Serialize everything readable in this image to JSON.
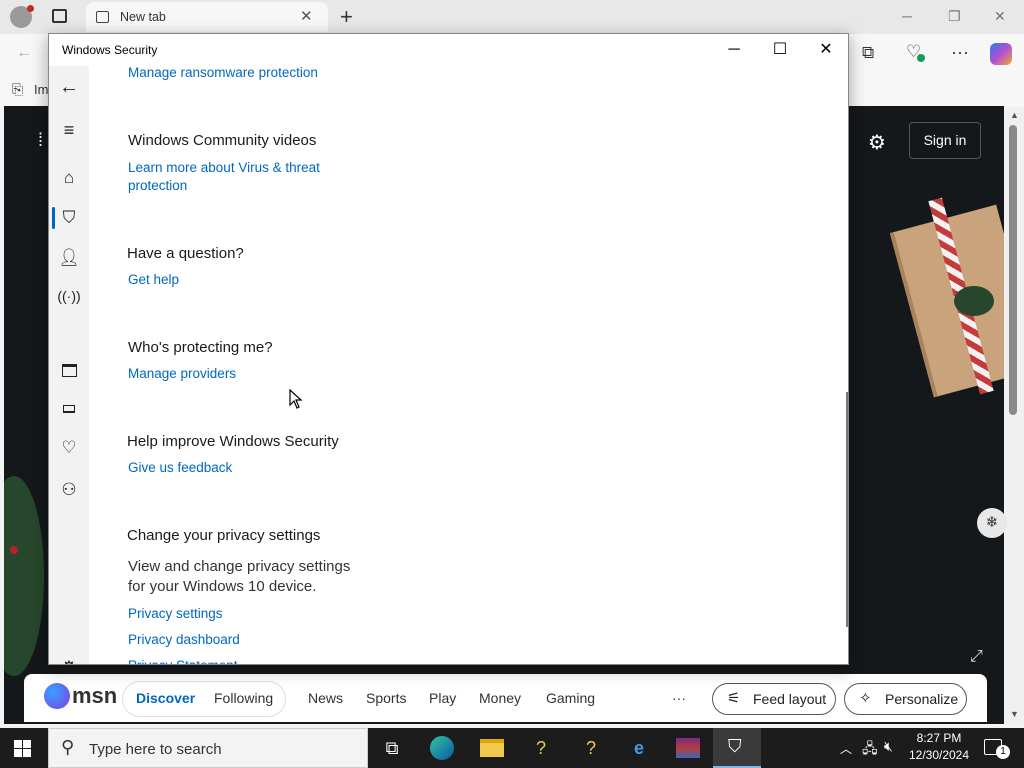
{
  "browser": {
    "tab_title": "New tab",
    "fav_partial": "Im",
    "page_signin": "Sign in"
  },
  "msn": {
    "logo": "msn",
    "nav": [
      "Discover",
      "Following",
      "News",
      "Sports",
      "Play",
      "Money",
      "Gaming"
    ],
    "more": "···",
    "feed_layout": "Feed layout",
    "personalize": "Personalize"
  },
  "ws": {
    "title": "Windows Security",
    "partial_top_link": "Manage ransomware protection",
    "sections": {
      "community_heading": "Windows Community videos",
      "community_link_1": "Learn more about Virus & threat",
      "community_link_2": "protection",
      "question_heading": "Have a question?",
      "question_link": "Get help",
      "protect_heading": "Who's protecting me?",
      "protect_link": "Manage providers",
      "improve_heading": "Help improve Windows Security",
      "improve_link": "Give us feedback",
      "privacy_heading": "Change your privacy settings",
      "privacy_body_1": "View and change privacy settings",
      "privacy_body_2": "for your Windows 10 device.",
      "privacy_link_1": "Privacy settings",
      "privacy_link_2": "Privacy dashboard",
      "privacy_link_3": "Privacy Statement"
    },
    "sidebar_icons": [
      "back-arrow-icon",
      "hamburger-menu-icon",
      "home-icon",
      "shield-icon",
      "person-icon",
      "wireless-icon",
      "app-browser-icon",
      "laptop-icon",
      "heart-health-icon",
      "family-icon",
      "settings-gear-icon"
    ]
  },
  "taskbar": {
    "search_placeholder": "Type here to search",
    "time": "8:27 PM",
    "date": "12/30/2024",
    "notification_count": "1"
  }
}
